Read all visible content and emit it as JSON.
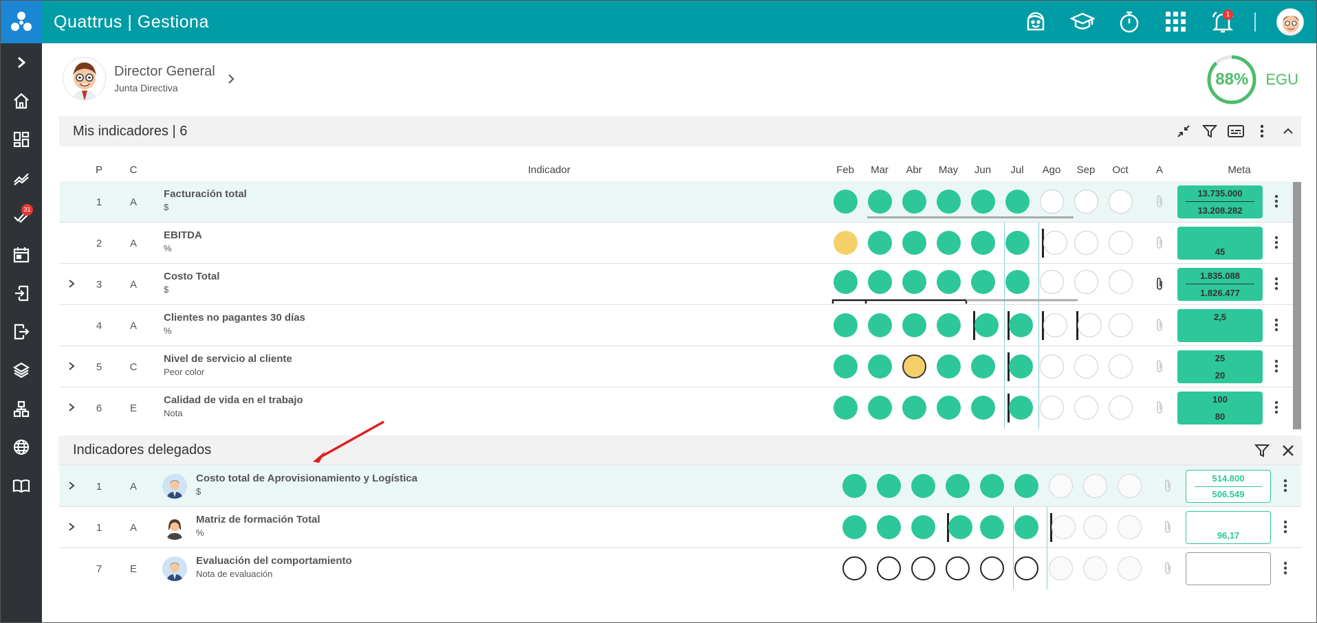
{
  "app": {
    "brand": "Quattrus",
    "separator": "|",
    "module": "Gestiona"
  },
  "topbar": {
    "notif_count": "1",
    "icons": [
      "support-face-icon",
      "graduation-cap-icon",
      "stopwatch-icon",
      "apps-grid-icon",
      "bell-icon"
    ]
  },
  "sidebar": {
    "items": [
      "chevron-right-icon",
      "home-icon",
      "dashboard-icon",
      "trend-icon",
      "tasks-check-icon",
      "calendar-icon",
      "login-icon",
      "logout-icon",
      "layers-icon",
      "org-chart-icon",
      "globe-icon",
      "book-icon"
    ],
    "tasks_badge": "31"
  },
  "profile": {
    "name": "Director General",
    "role": "Junta Directiva"
  },
  "egu": {
    "value": "88%",
    "label": "EGU",
    "percent": 88,
    "color": "#4cbc6b"
  },
  "mis": {
    "title": "Mis indicadores | 6",
    "columns": {
      "p": "P",
      "c": "C",
      "indicador": "Indicador",
      "months": [
        "Feb",
        "Mar",
        "Abr",
        "May",
        "Jun",
        "Jul",
        "Ago",
        "Sep",
        "Oct"
      ],
      "a": "A",
      "meta": "Meta"
    },
    "rows": [
      {
        "p": "1",
        "c": "A",
        "name": "Facturación total",
        "unit": "$",
        "meta_top": "13.735.000",
        "meta_bottom": "13.208.282",
        "expand": false
      },
      {
        "p": "2",
        "c": "A",
        "name": "EBITDA",
        "unit": "%",
        "meta_top": "",
        "meta_bottom": "45",
        "expand": false
      },
      {
        "p": "3",
        "c": "A",
        "name": "Costo Total",
        "unit": "$",
        "meta_top": "1.835.088",
        "meta_bottom": "1.826.477",
        "expand": true
      },
      {
        "p": "4",
        "c": "A",
        "name": "Clientes no pagantes 30 días",
        "unit": "%",
        "meta_top": "2,5",
        "meta_bottom": "",
        "expand": false
      },
      {
        "p": "5",
        "c": "C",
        "name": "Nivel de servicio al cliente",
        "unit": "Peor color",
        "meta_top": "25",
        "meta_bottom": "20",
        "expand": true
      },
      {
        "p": "6",
        "c": "E",
        "name": "Calidad de vida en el trabajo",
        "unit": "Nota",
        "meta_top": "100",
        "meta_bottom": "80",
        "expand": true
      }
    ]
  },
  "delegados": {
    "title": "Indicadores delegados",
    "rows": [
      {
        "p": "1",
        "c": "A",
        "name": "Costo total de Aprovisionamiento y Logística",
        "unit": "$",
        "meta_top": "514.800",
        "meta_bottom": "506.549",
        "expand": true
      },
      {
        "p": "1",
        "c": "A",
        "name": "Matriz de formación Total",
        "unit": "%",
        "meta_top": "",
        "meta_bottom": "96,17",
        "expand": true
      },
      {
        "p": "7",
        "c": "E",
        "name": "Evaluación del comportamiento",
        "unit": "Nota de evaluación",
        "meta_top": "",
        "meta_bottom": "",
        "expand": false
      }
    ]
  },
  "colors": {
    "teal": "#009ca6",
    "green": "#2dc79a",
    "yellow": "#f5d06a",
    "sidebar": "#2f3338"
  }
}
